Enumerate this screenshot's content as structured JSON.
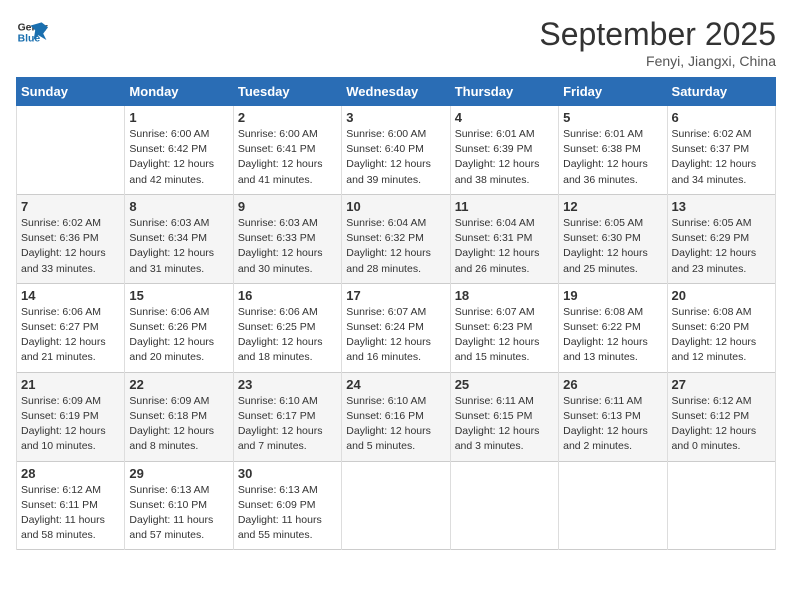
{
  "logo": {
    "line1": "General",
    "line2": "Blue"
  },
  "title": "September 2025",
  "location": "Fenyi, Jiangxi, China",
  "weekdays": [
    "Sunday",
    "Monday",
    "Tuesday",
    "Wednesday",
    "Thursday",
    "Friday",
    "Saturday"
  ],
  "weeks": [
    [
      {
        "num": "",
        "info": ""
      },
      {
        "num": "1",
        "info": "Sunrise: 6:00 AM\nSunset: 6:42 PM\nDaylight: 12 hours\nand 42 minutes."
      },
      {
        "num": "2",
        "info": "Sunrise: 6:00 AM\nSunset: 6:41 PM\nDaylight: 12 hours\nand 41 minutes."
      },
      {
        "num": "3",
        "info": "Sunrise: 6:00 AM\nSunset: 6:40 PM\nDaylight: 12 hours\nand 39 minutes."
      },
      {
        "num": "4",
        "info": "Sunrise: 6:01 AM\nSunset: 6:39 PM\nDaylight: 12 hours\nand 38 minutes."
      },
      {
        "num": "5",
        "info": "Sunrise: 6:01 AM\nSunset: 6:38 PM\nDaylight: 12 hours\nand 36 minutes."
      },
      {
        "num": "6",
        "info": "Sunrise: 6:02 AM\nSunset: 6:37 PM\nDaylight: 12 hours\nand 34 minutes."
      }
    ],
    [
      {
        "num": "7",
        "info": "Sunrise: 6:02 AM\nSunset: 6:36 PM\nDaylight: 12 hours\nand 33 minutes."
      },
      {
        "num": "8",
        "info": "Sunrise: 6:03 AM\nSunset: 6:34 PM\nDaylight: 12 hours\nand 31 minutes."
      },
      {
        "num": "9",
        "info": "Sunrise: 6:03 AM\nSunset: 6:33 PM\nDaylight: 12 hours\nand 30 minutes."
      },
      {
        "num": "10",
        "info": "Sunrise: 6:04 AM\nSunset: 6:32 PM\nDaylight: 12 hours\nand 28 minutes."
      },
      {
        "num": "11",
        "info": "Sunrise: 6:04 AM\nSunset: 6:31 PM\nDaylight: 12 hours\nand 26 minutes."
      },
      {
        "num": "12",
        "info": "Sunrise: 6:05 AM\nSunset: 6:30 PM\nDaylight: 12 hours\nand 25 minutes."
      },
      {
        "num": "13",
        "info": "Sunrise: 6:05 AM\nSunset: 6:29 PM\nDaylight: 12 hours\nand 23 minutes."
      }
    ],
    [
      {
        "num": "14",
        "info": "Sunrise: 6:06 AM\nSunset: 6:27 PM\nDaylight: 12 hours\nand 21 minutes."
      },
      {
        "num": "15",
        "info": "Sunrise: 6:06 AM\nSunset: 6:26 PM\nDaylight: 12 hours\nand 20 minutes."
      },
      {
        "num": "16",
        "info": "Sunrise: 6:06 AM\nSunset: 6:25 PM\nDaylight: 12 hours\nand 18 minutes."
      },
      {
        "num": "17",
        "info": "Sunrise: 6:07 AM\nSunset: 6:24 PM\nDaylight: 12 hours\nand 16 minutes."
      },
      {
        "num": "18",
        "info": "Sunrise: 6:07 AM\nSunset: 6:23 PM\nDaylight: 12 hours\nand 15 minutes."
      },
      {
        "num": "19",
        "info": "Sunrise: 6:08 AM\nSunset: 6:22 PM\nDaylight: 12 hours\nand 13 minutes."
      },
      {
        "num": "20",
        "info": "Sunrise: 6:08 AM\nSunset: 6:20 PM\nDaylight: 12 hours\nand 12 minutes."
      }
    ],
    [
      {
        "num": "21",
        "info": "Sunrise: 6:09 AM\nSunset: 6:19 PM\nDaylight: 12 hours\nand 10 minutes."
      },
      {
        "num": "22",
        "info": "Sunrise: 6:09 AM\nSunset: 6:18 PM\nDaylight: 12 hours\nand 8 minutes."
      },
      {
        "num": "23",
        "info": "Sunrise: 6:10 AM\nSunset: 6:17 PM\nDaylight: 12 hours\nand 7 minutes."
      },
      {
        "num": "24",
        "info": "Sunrise: 6:10 AM\nSunset: 6:16 PM\nDaylight: 12 hours\nand 5 minutes."
      },
      {
        "num": "25",
        "info": "Sunrise: 6:11 AM\nSunset: 6:15 PM\nDaylight: 12 hours\nand 3 minutes."
      },
      {
        "num": "26",
        "info": "Sunrise: 6:11 AM\nSunset: 6:13 PM\nDaylight: 12 hours\nand 2 minutes."
      },
      {
        "num": "27",
        "info": "Sunrise: 6:12 AM\nSunset: 6:12 PM\nDaylight: 12 hours\nand 0 minutes."
      }
    ],
    [
      {
        "num": "28",
        "info": "Sunrise: 6:12 AM\nSunset: 6:11 PM\nDaylight: 11 hours\nand 58 minutes."
      },
      {
        "num": "29",
        "info": "Sunrise: 6:13 AM\nSunset: 6:10 PM\nDaylight: 11 hours\nand 57 minutes."
      },
      {
        "num": "30",
        "info": "Sunrise: 6:13 AM\nSunset: 6:09 PM\nDaylight: 11 hours\nand 55 minutes."
      },
      {
        "num": "",
        "info": ""
      },
      {
        "num": "",
        "info": ""
      },
      {
        "num": "",
        "info": ""
      },
      {
        "num": "",
        "info": ""
      }
    ]
  ]
}
